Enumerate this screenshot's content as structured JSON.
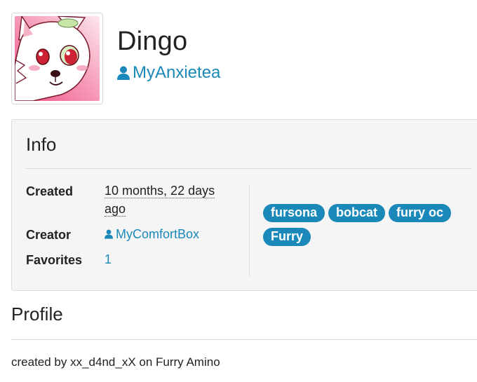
{
  "character": {
    "name": "Dingo",
    "owner": "MyAnxietea"
  },
  "info": {
    "title": "Info",
    "created_label": "Created",
    "created_value_line1": "10 months, 22 days",
    "created_value_line2": "ago",
    "creator_label": "Creator",
    "creator_value": "MyComfortBox",
    "favorites_label": "Favorites",
    "favorites_value": "1",
    "tags": [
      "fursona",
      "bobcat",
      "furry oc",
      "Furry"
    ]
  },
  "profile": {
    "title": "Profile",
    "text": "created by xx_d4nd_xX on Furry Amino"
  },
  "colors": {
    "link": "#1a88b8",
    "panel_bg": "#f5f5f5",
    "tag_bg": "#1a88b8"
  }
}
